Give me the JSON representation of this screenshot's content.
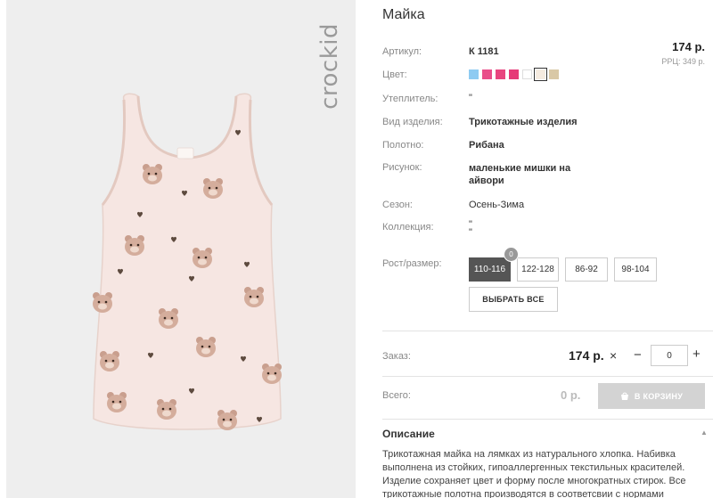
{
  "photo": {
    "brand": "crockid",
    "shirt_color": "#f6e6e2",
    "accent_color": "#c9a293"
  },
  "product": {
    "title": "Майка",
    "price": "174 р.",
    "rrp": "РРЦ: 349 р.",
    "specs": [
      {
        "label": "Артикул:",
        "value": "К 1181"
      },
      {
        "label": "Цвет:",
        "value": ""
      },
      {
        "label": "Утеплитель:",
        "value": "\""
      },
      {
        "label": "Вид изделия:",
        "value": "Трикотажные изделия"
      },
      {
        "label": "Полотно:",
        "value": "Рибана"
      },
      {
        "label": "Рисунок:",
        "value": "маленькие мишки на айвори"
      },
      {
        "label": "Сезон:",
        "value": "Осень-Зима"
      },
      {
        "label": "Коллекция:",
        "value": "\"\n\""
      },
      {
        "label": "Рост/размер:",
        "value": ""
      }
    ],
    "colors": [
      {
        "hex": "#8ecbf2",
        "selected": false
      },
      {
        "hex": "#e94e8a",
        "selected": false
      },
      {
        "hex": "#e8457f",
        "selected": false
      },
      {
        "hex": "#e63a78",
        "selected": false
      },
      {
        "hex": "#ffffff",
        "selected": false
      },
      {
        "hex": "#f5ebe0",
        "selected": true
      },
      {
        "hex": "#d9c8a6",
        "selected": false
      }
    ],
    "sizes": [
      {
        "label": "110-116",
        "active": true,
        "badge": "0"
      },
      {
        "label": "122-128",
        "active": false
      },
      {
        "label": "86-92",
        "active": false
      },
      {
        "label": "98-104",
        "active": false
      }
    ],
    "select_all_label": "ВЫБРАТЬ ВСЕ"
  },
  "order": {
    "label": "Заказ:",
    "price": "174 р.",
    "times": "×",
    "minus": "−",
    "qty": "0",
    "plus": "+"
  },
  "total": {
    "label": "Всего:",
    "value": "0 р.",
    "cart_label": "В КОРЗИНУ"
  },
  "description": {
    "heading": "Описание",
    "text": "Трикотажная майка на лямках из натурального хлопка. Набивка выполнена из стойких, гипоаллергенных текстильных красителей. Изделие сохраняет цвет и форму после многократных стирок. Все трикотажные полотна производятся в соответсвии с нормами"
  }
}
